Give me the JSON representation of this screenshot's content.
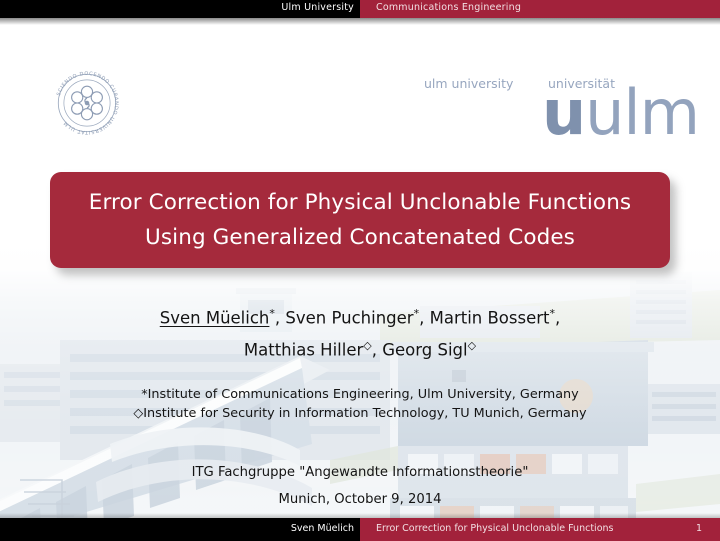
{
  "header": {
    "left_label": "Ulm University",
    "right_label": "Communications Engineering",
    "black_color": "#000000",
    "red_color": "#a2223b"
  },
  "logos": {
    "seal": {
      "icon": "ulm-university-seal",
      "motto_text": "SCIENDO DOCENDO CURANDO UNIVERSITAT ULM",
      "color": "#8d9cb4"
    },
    "uulm": {
      "sub_english": "ulm university",
      "sub_german": "universität",
      "wordmark": "uulm",
      "color": "#93a3bd"
    }
  },
  "title_box": {
    "line1": "Error Correction for Physical Unclonable Functions",
    "line2": "Using Generalized Concatenated Codes",
    "background_color": "#a52a3c",
    "text_color": "#ffffff"
  },
  "authors": {
    "line1_parts": [
      {
        "name": "Sven Müelich",
        "mark": "*",
        "underlined": true,
        "trailing": ", "
      },
      {
        "name": "Sven Puchinger",
        "mark": "*",
        "underlined": false,
        "trailing": ", "
      },
      {
        "name": "Martin Bossert",
        "mark": "*",
        "underlined": false,
        "trailing": ","
      }
    ],
    "line2_parts": [
      {
        "name": "Matthias Hiller",
        "mark": "◇",
        "underlined": false,
        "trailing": ", "
      },
      {
        "name": "Georg Sigl",
        "mark": "◇",
        "underlined": false,
        "trailing": ""
      }
    ]
  },
  "affiliations": {
    "line1": "*Institute of Communications Engineering, Ulm University, Germany",
    "line2": "◇Institute for Security in Information Technology, TU Munich, Germany"
  },
  "event": {
    "line1": "ITG Fachgruppe \"Angewandte Informationstheorie\"",
    "line2": "Munich, October 9, 2014"
  },
  "footer": {
    "author": "Sven Müelich",
    "title": "Error Correction for Physical Unclonable Functions",
    "page_number": "1",
    "black_color": "#000000",
    "red_color": "#a2223b"
  }
}
